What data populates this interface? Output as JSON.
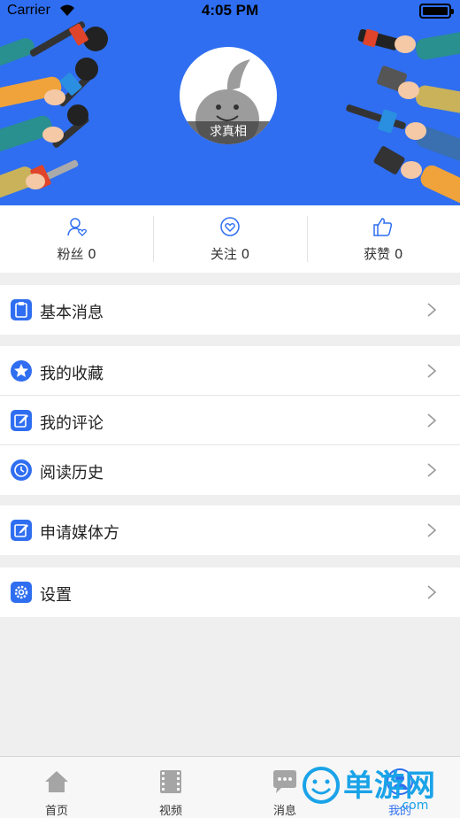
{
  "status_bar": {
    "carrier": "Carrier",
    "time": "4:05 PM"
  },
  "profile": {
    "name": "求真相"
  },
  "stats": [
    {
      "label": "粉丝 0",
      "icon": "user-heart-icon"
    },
    {
      "label": "关注 0",
      "icon": "heart-circle-icon"
    },
    {
      "label": "获赞 0",
      "icon": "thumbs-up-icon"
    }
  ],
  "menu": {
    "basic_info": "基本消息",
    "favorites": "我的收藏",
    "comments": "我的评论",
    "history": "阅读历史",
    "media_apply": "申请媒体方",
    "settings": "设置"
  },
  "tabbar": {
    "home": "首页",
    "video": "视频",
    "messages": "消息",
    "mine": "我的"
  },
  "watermark": {
    "text": "单游网",
    "sub": ".com"
  },
  "colors": {
    "accent": "#2f6ef0",
    "header_bg": "#2f6ef0",
    "watermark": "#1aa3e8"
  }
}
